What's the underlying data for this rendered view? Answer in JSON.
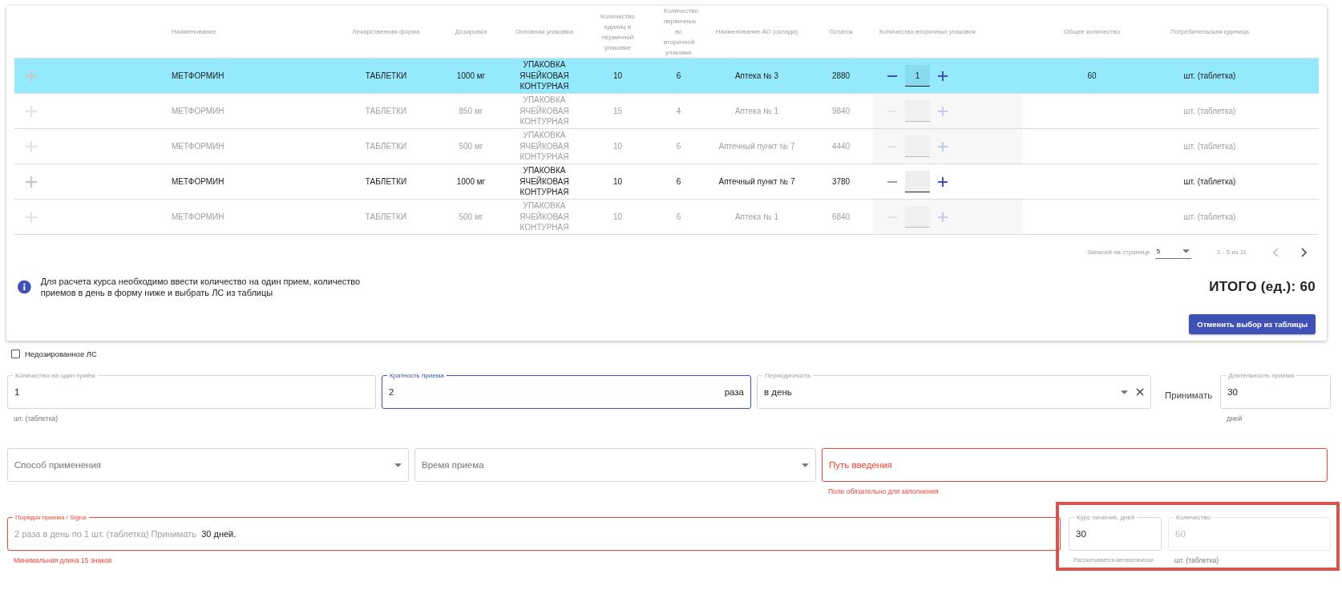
{
  "table": {
    "columns": [
      "Наименование",
      "Лекарственная форма",
      "Дозировка",
      "Основная упаковка",
      "Количество единиц в первичной упаковке",
      "Количество первичных во вторичной упаковке",
      "Наименование АО (склада)",
      "Остаток",
      "Количество вторичных упаковок",
      "Общее количество",
      "Потребительская единица"
    ],
    "rows": [
      {
        "name": "МЕТФОРМИН",
        "form": "ТАБЛЕТКИ",
        "dose": "1000 мг",
        "package": "УПАКОВКА ЯЧЕЙКОВАЯ КОНТУРНАЯ",
        "units": "10",
        "primary": "6",
        "pharmacy": "Аптека № 3",
        "stock": "2880",
        "quantity": "1",
        "total": "60",
        "unit": "шт. (таблетка)",
        "selected": true,
        "disabled": false
      },
      {
        "name": "МЕТФОРМИН",
        "form": "ТАБЛЕТКИ",
        "dose": "850 мг",
        "package": "УПАКОВКА ЯЧЕЙКОВАЯ КОНТУРНАЯ",
        "units": "15",
        "primary": "4",
        "pharmacy": "Аптека № 1",
        "stock": "9840",
        "unit": "шт. (таблетка)",
        "selected": false,
        "disabled": true
      },
      {
        "name": "МЕТФОРМИН",
        "form": "ТАБЛЕТКИ",
        "dose": "500 мг",
        "package": "УПАКОВКА ЯЧЕЙКОВАЯ КОНТУРНАЯ",
        "units": "10",
        "primary": "6",
        "pharmacy": "Аптечный пункт № 7",
        "stock": "4440",
        "unit": "шт. (таблетка)",
        "selected": false,
        "disabled": true
      },
      {
        "name": "МЕТФОРМИН",
        "form": "ТАБЛЕТКИ",
        "dose": "1000 мг",
        "package": "УПАКОВКА ЯЧЕЙКОВАЯ КОНТУРНАЯ",
        "units": "10",
        "primary": "6",
        "pharmacy": "Аптечный пункт № 7",
        "stock": "3780",
        "unit": "шт. (таблетка)",
        "selected": false,
        "disabled": false
      },
      {
        "name": "МЕТФОРМИН",
        "form": "ТАБЛЕТКИ",
        "dose": "500 мг",
        "package": "УПАКОВКА ЯЧЕЙКОВАЯ КОНТУРНАЯ",
        "units": "10",
        "primary": "6",
        "pharmacy": "Аптека № 1",
        "stock": "6840",
        "unit": "шт. (таблетка)",
        "selected": false,
        "disabled": true
      }
    ]
  },
  "pagination": {
    "label": "Записей на странице",
    "page_size": "5",
    "range": "1 - 5 из 11",
    "prev_disabled": true,
    "next_disabled": false
  },
  "info": "Для расчета курса необходимо ввести количество на один прием, количество приемов в день в форму ниже и выбрать ЛС из таблицы",
  "total": "ИТОГО (ед.): 60",
  "cancel_button": "Отменить выбор из таблицы",
  "undosed": {
    "label": "Недозированное ЛС",
    "checked": false
  },
  "dosage_row": [
    {
      "kind": "text",
      "label": "Количество на один приём",
      "value": "1",
      "helper": "шт. (таблетка)",
      "focused": false,
      "error": false
    },
    {
      "kind": "text",
      "label": "Кратность приема",
      "value": "2",
      "suffix": "раза",
      "focused": true,
      "error": false
    },
    {
      "kind": "select",
      "label": "Периодичность",
      "value": "в день",
      "clearable": true,
      "focused": false,
      "error": false
    },
    {
      "kind": "caption",
      "text": "Принимать"
    },
    {
      "kind": "text",
      "label": "Длительность приема",
      "value": "30",
      "helper": "дней",
      "focused": false,
      "error": false
    }
  ],
  "administration_row": [
    {
      "kind": "select",
      "placeholder": "Способ применения",
      "focused": false,
      "error": false
    },
    {
      "kind": "select",
      "placeholder": "Время приема",
      "focused": false,
      "error": false
    },
    {
      "kind": "text",
      "placeholder": "Путь введения",
      "helper": "Поле обязательно для заполнения",
      "focused": false,
      "error": true
    }
  ],
  "signa": {
    "label": "Порядок приема / Signa",
    "value_parts": [
      {
        "text": "2 раза в день по 1 шт. (таблетка) Принимать",
        "muted": true
      },
      {
        "text": "30 дней.",
        "muted": false
      }
    ],
    "helper": "Минимальная длина 15 знаков",
    "error": true
  },
  "calculated": {
    "highlighted": true,
    "fields": [
      {
        "label": "Курс лечения, дней",
        "value": "30",
        "helper": "Рассчитывается автоматически",
        "disabled": false
      },
      {
        "label": "Количество",
        "value": "60",
        "helper": "шт. (таблетка)",
        "disabled": true
      }
    ]
  }
}
